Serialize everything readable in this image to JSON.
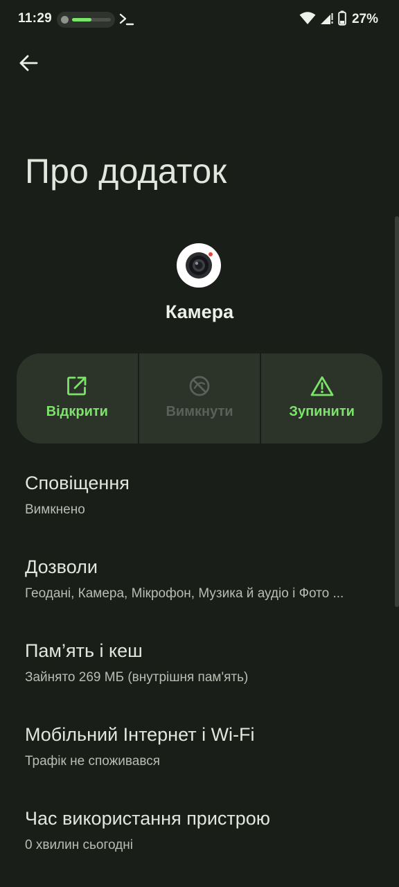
{
  "status_bar": {
    "time": "11:29",
    "battery_percent": "27%",
    "download_progress": 0.5,
    "accent_color": "#7ae76a",
    "icons": [
      "record-dot-icon",
      "terminal-icon",
      "wifi-icon",
      "signal-icon",
      "battery-icon"
    ]
  },
  "header": {
    "title": "Про додаток"
  },
  "app": {
    "name": "Камера",
    "icon": "camera-app-icon"
  },
  "actions": [
    {
      "label": "Відкрити",
      "icon": "open-external-icon",
      "enabled": true
    },
    {
      "label": "Вимкнути",
      "icon": "disable-icon",
      "enabled": false
    },
    {
      "label": "Зупинити",
      "icon": "warning-icon",
      "enabled": true
    }
  ],
  "settings": [
    {
      "title": "Сповіщення",
      "subtitle": "Вимкнено"
    },
    {
      "title": "Дозволи",
      "subtitle": "Геодані, Камера, Мікрофон, Музика й аудіо і Фото ..."
    },
    {
      "title": "Пам’ять і кеш",
      "subtitle": "Зайнято 269 МБ (внутрішня пам'ять)"
    },
    {
      "title": "Мобільний Інтернет і Wi-Fi",
      "subtitle": "Трафік не споживався"
    },
    {
      "title": "Час використання пристрою",
      "subtitle": "0 хвилин сьогодні"
    }
  ],
  "colors": {
    "background": "#1a1e18",
    "button_surface": "#2c3329",
    "accent_green": "#7ce46a",
    "disabled_text": "#5b6158"
  }
}
